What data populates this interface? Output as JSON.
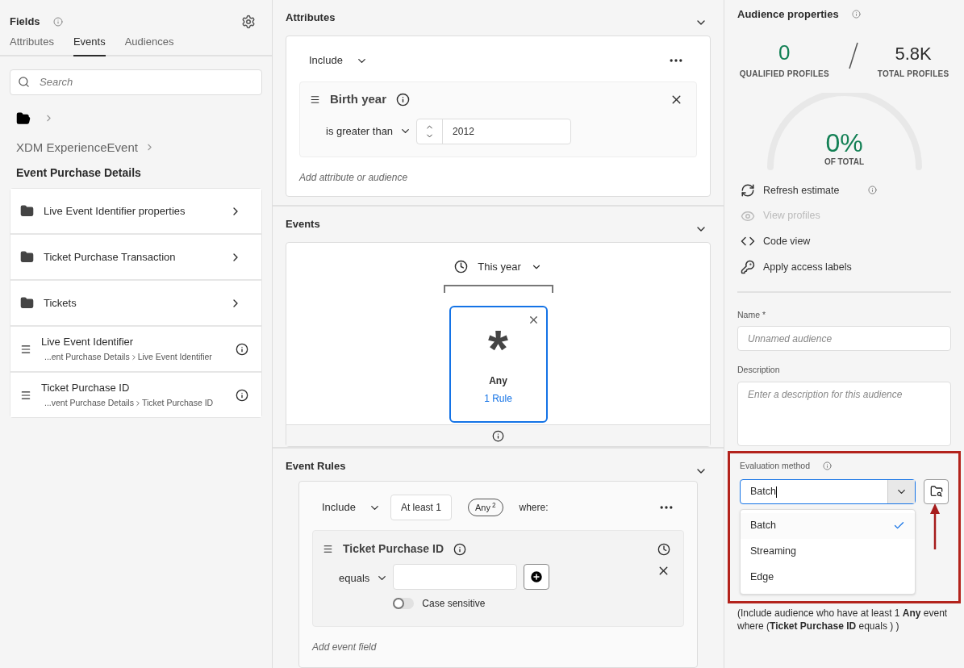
{
  "fields_panel": {
    "title": "Fields",
    "tabs": [
      {
        "label": "Attributes",
        "selected": false
      },
      {
        "label": "Events",
        "selected": true
      },
      {
        "label": "Audiences",
        "selected": false
      }
    ],
    "search": {
      "placeholder": "Search"
    },
    "breadcrumb": "XDM ExperienceEvent",
    "heading": "Event Purchase Details",
    "items": [
      {
        "kind": "folder",
        "label": "Live Event Identifier properties"
      },
      {
        "kind": "folder",
        "label": "Ticket Purchase Transaction"
      },
      {
        "kind": "folder",
        "label": "Tickets"
      },
      {
        "kind": "field",
        "label": "Live Event Identifier",
        "path": "...ent Purchase Details",
        "leaf": "Live Event Identifier"
      },
      {
        "kind": "field",
        "label": "Ticket Purchase ID",
        "path": "...vent Purchase Details",
        "leaf": "Ticket Purchase ID"
      }
    ]
  },
  "attributes": {
    "title": "Attributes",
    "include": "Include",
    "rule": {
      "field": "Birth year",
      "operator": "is greater than",
      "value": "2012"
    },
    "add": "Add attribute or audience"
  },
  "events": {
    "title": "Events",
    "time": "This year",
    "card": {
      "name": "Any",
      "rules": "1 Rule",
      "symbol": "*"
    }
  },
  "event_rules": {
    "title": "Event Rules",
    "include": "Include",
    "count": "At least 1",
    "any": "Any",
    "any_sup": "2",
    "where": "where:",
    "rule": {
      "field": "Ticket Purchase ID",
      "operator": "equals",
      "case_label": "Case sensitive",
      "case_sensitive": false
    },
    "add": "Add event field"
  },
  "properties": {
    "title": "Audience properties",
    "qualified": "0",
    "qualified_label": "QUALIFIED PROFILES",
    "total": "5.8K",
    "total_label": "TOTAL PROFILES",
    "percent": "0%",
    "percent_label": "OF TOTAL",
    "actions": [
      {
        "kind": "refresh",
        "label": "Refresh estimate",
        "disabled": false,
        "info": true
      },
      {
        "kind": "eye",
        "label": "View profiles",
        "disabled": true,
        "info": false
      },
      {
        "kind": "code",
        "label": "Code view",
        "disabled": false,
        "info": false
      },
      {
        "kind": "key",
        "label": "Apply access labels",
        "disabled": false,
        "info": false
      }
    ],
    "name": {
      "label": "Name *",
      "placeholder": "Unnamed audience"
    },
    "description": {
      "label": "Description",
      "placeholder": "Enter a description for this audience"
    },
    "evaluation": {
      "label": "Evaluation method",
      "value": "Batch",
      "options": [
        {
          "label": "Batch",
          "selected": true
        },
        {
          "label": "Streaming",
          "selected": false
        },
        {
          "label": "Edge",
          "selected": false
        }
      ]
    },
    "summary": "(Include audience who have at least 1 **Any** event where (**Ticket Purchase ID** equals ) )"
  }
}
